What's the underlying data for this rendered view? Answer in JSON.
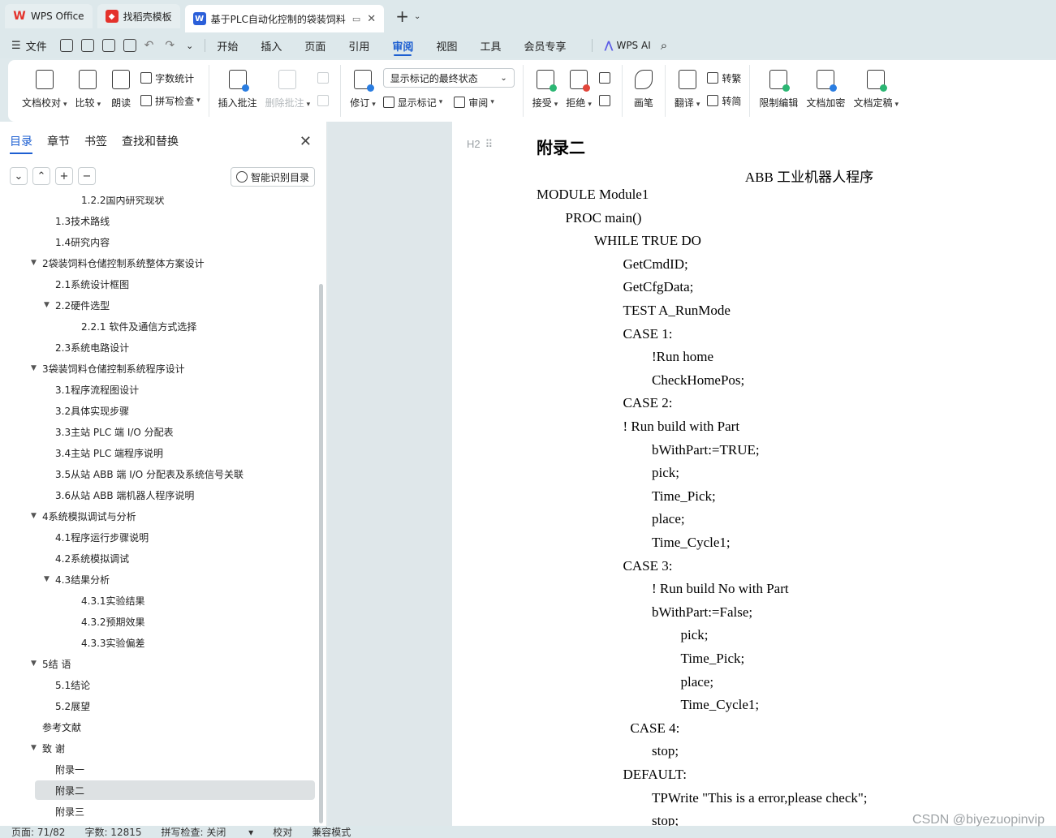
{
  "tabs": [
    {
      "label": "WPS Office",
      "color": "#e4322b",
      "logo": "W"
    },
    {
      "label": "找稻壳模板",
      "color": "#e4322b",
      "logo": "◆"
    },
    {
      "label": "基于PLC自动化控制的袋装饲料",
      "color": "#2b5fd9",
      "logo": "W"
    }
  ],
  "menu": {
    "file": "文件",
    "items": [
      "开始",
      "插入",
      "页面",
      "引用",
      "审阅",
      "视图",
      "工具",
      "会员专享"
    ],
    "active": "审阅",
    "ai": "WPS AI"
  },
  "ribbon": {
    "doc_check": "文档校对",
    "compare": "比较",
    "read_aloud": "朗读",
    "word_count": "字数统计",
    "spell_check": "拼写检查",
    "insert_comment": "插入批注",
    "delete_comment": "删除批注",
    "revise": "修订",
    "markup_combo": "显示标记的最终状态",
    "show_markup": "显示标记",
    "review": "审阅",
    "accept": "接受",
    "reject": "拒绝",
    "pen": "画笔",
    "translate": "翻译",
    "to_traditional": "转繁",
    "to_simplified": "转简",
    "restrict_edit": "限制编辑",
    "encrypt": "文档加密",
    "finalize": "文档定稿"
  },
  "sidebar": {
    "tabs": [
      "目录",
      "章节",
      "书签",
      "查找和替换"
    ],
    "smart_toc": "智能识别目录",
    "toc": [
      {
        "label": "1.2.2国内研究现状",
        "level": 3,
        "arrow": ""
      },
      {
        "label": "1.3技术路线",
        "level": 2,
        "arrow": ""
      },
      {
        "label": "1.4研究内容",
        "level": 2,
        "arrow": ""
      },
      {
        "label": "2袋装饲料仓储控制系统整体方案设计",
        "level": 1,
        "arrow": "▼"
      },
      {
        "label": "2.1系统设计框图",
        "level": 2,
        "arrow": ""
      },
      {
        "label": "2.2硬件选型",
        "level": 2,
        "arrow": "▼"
      },
      {
        "label": "2.2.1 软件及通信方式选择",
        "level": 3,
        "arrow": ""
      },
      {
        "label": "2.3系统电路设计",
        "level": 2,
        "arrow": ""
      },
      {
        "label": "3袋装饲料仓储控制系统程序设计",
        "level": 1,
        "arrow": "▼"
      },
      {
        "label": "3.1程序流程图设计",
        "level": 2,
        "arrow": ""
      },
      {
        "label": "3.2具体实现步骤",
        "level": 2,
        "arrow": ""
      },
      {
        "label": "3.3主站 PLC 端 I/O 分配表",
        "level": 2,
        "arrow": ""
      },
      {
        "label": "3.4主站 PLC 端程序说明",
        "level": 2,
        "arrow": ""
      },
      {
        "label": "3.5从站 ABB 端 I/O 分配表及系统信号关联",
        "level": 2,
        "arrow": ""
      },
      {
        "label": "3.6从站 ABB 端机器人程序说明",
        "level": 2,
        "arrow": ""
      },
      {
        "label": "4系统模拟调试与分析",
        "level": 1,
        "arrow": "▼"
      },
      {
        "label": "4.1程序运行步骤说明",
        "level": 2,
        "arrow": ""
      },
      {
        "label": "4.2系统模拟调试",
        "level": 2,
        "arrow": ""
      },
      {
        "label": "4.3结果分析",
        "level": 2,
        "arrow": "▼"
      },
      {
        "label": "4.3.1实验结果",
        "level": 3,
        "arrow": ""
      },
      {
        "label": "4.3.2预期效果",
        "level": 3,
        "arrow": ""
      },
      {
        "label": "4.3.3实验偏差",
        "level": 3,
        "arrow": ""
      },
      {
        "label": "5结 语",
        "level": 1,
        "arrow": "▼"
      },
      {
        "label": "5.1结论",
        "level": 2,
        "arrow": ""
      },
      {
        "label": "5.2展望",
        "level": 2,
        "arrow": ""
      },
      {
        "label": "参考文献",
        "level": 1,
        "arrow": ""
      },
      {
        "label": "致 谢",
        "level": 1,
        "arrow": "▼"
      },
      {
        "label": "附录一",
        "level": 2,
        "arrow": ""
      },
      {
        "label": "附录二",
        "level": 2,
        "arrow": "",
        "selected": true
      },
      {
        "label": "附录三",
        "level": 2,
        "arrow": ""
      }
    ]
  },
  "document": {
    "heading_marker": "H2",
    "heading": "附录二",
    "subtitle": "ABB 工业机器人程序",
    "lines": [
      {
        "text": "MODULE Module1",
        "indent": 0
      },
      {
        "text": "PROC main()",
        "indent": 1
      },
      {
        "text": "WHILE TRUE DO",
        "indent": 2
      },
      {
        "text": "GetCmdID;",
        "indent": 3
      },
      {
        "text": "GetCfgData;",
        "indent": 3
      },
      {
        "text": "TEST A_RunMode",
        "indent": 3
      },
      {
        "text": "CASE 1:",
        "indent": 3
      },
      {
        "text": "!Run    home",
        "indent": 4
      },
      {
        "text": "CheckHomePos;",
        "indent": 4
      },
      {
        "text": "CASE 2:",
        "indent": 3
      },
      {
        "text": "! Run build with Part",
        "indent": 3
      },
      {
        "text": "bWithPart:=TRUE;",
        "indent": 4
      },
      {
        "text": "pick;",
        "indent": 4
      },
      {
        "text": "Time_Pick;",
        "indent": 4
      },
      {
        "text": "place;",
        "indent": 4
      },
      {
        "text": "Time_Cycle1;",
        "indent": 4
      },
      {
        "text": "CASE 3:",
        "indent": 3
      },
      {
        "text": "! Run build No with Part",
        "indent": 4
      },
      {
        "text": "bWithPart:=False;",
        "indent": 4
      },
      {
        "text": "pick;",
        "indent": 5
      },
      {
        "text": "Time_Pick;",
        "indent": 5
      },
      {
        "text": "place;",
        "indent": 5
      },
      {
        "text": "Time_Cycle1;",
        "indent": 5
      },
      {
        "text": "CASE 4:",
        "indent": 3.25
      },
      {
        "text": "stop;",
        "indent": 4
      },
      {
        "text": "DEFAULT:",
        "indent": 3
      },
      {
        "text": "TPWrite \"This is a error,please check\";",
        "indent": 4
      },
      {
        "text": "stop;",
        "indent": 4
      }
    ]
  },
  "status": {
    "page": "页面: 71/82",
    "words": "字数: 12815",
    "spell": "拼写检查: 关闭",
    "proof": "校对",
    "compat": "兼容模式"
  },
  "watermark": "CSDN @biyezuopinvip"
}
